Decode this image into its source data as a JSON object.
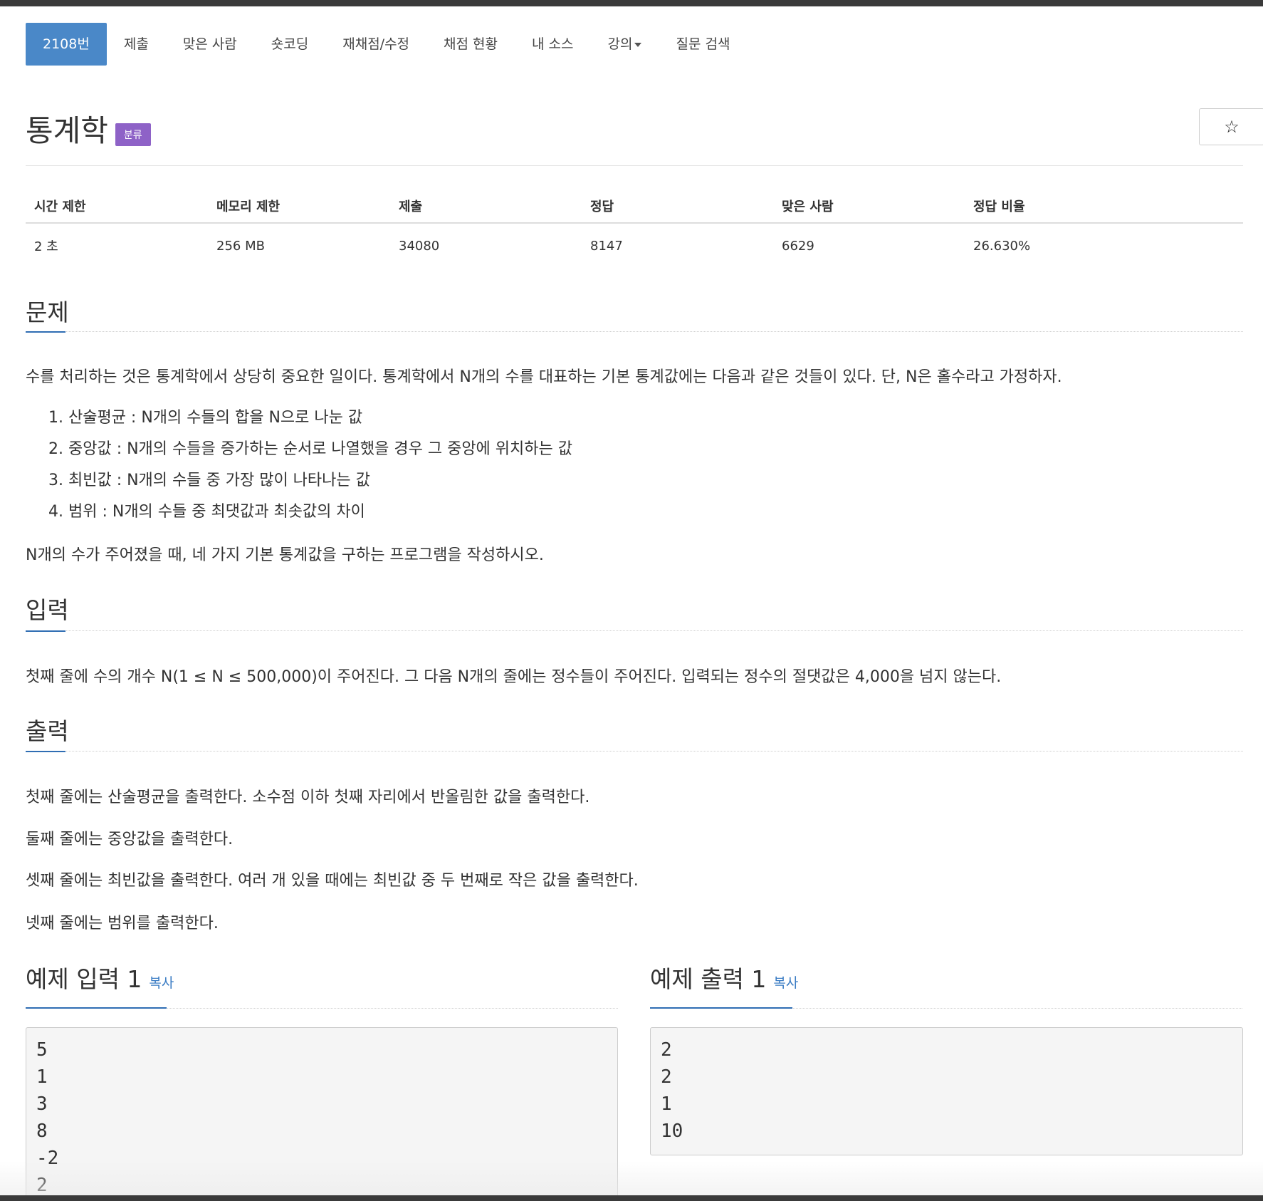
{
  "nav": {
    "items": [
      {
        "label": "2108번",
        "active": true
      },
      {
        "label": "제출"
      },
      {
        "label": "맞은 사람"
      },
      {
        "label": "숏코딩"
      },
      {
        "label": "재채점/수정"
      },
      {
        "label": "채점 현황"
      },
      {
        "label": "내 소스"
      },
      {
        "label": "강의",
        "dropdown": true
      },
      {
        "label": "질문 검색"
      }
    ]
  },
  "problem": {
    "title": "통계학",
    "tag": "분류",
    "star": "☆"
  },
  "info": {
    "headers": [
      "시간 제한",
      "메모리 제한",
      "제출",
      "정답",
      "맞은 사람",
      "정답 비율"
    ],
    "values": [
      "2 초",
      "256 MB",
      "34080",
      "8147",
      "6629",
      "26.630%"
    ]
  },
  "description": {
    "heading": "문제",
    "intro": "수를 처리하는 것은 통계학에서 상당히 중요한 일이다. 통계학에서 N개의 수를 대표하는 기본 통계값에는 다음과 같은 것들이 있다. 단, N은 홀수라고 가정하자.",
    "list": [
      "1. 산술평균 : N개의 수들의 합을 N으로 나눈 값",
      "2. 중앙값 : N개의 수들을 증가하는 순서로 나열했을 경우 그 중앙에 위치하는 값",
      "3. 최빈값 : N개의 수들 중 가장 많이 나타나는 값",
      "4. 범위 : N개의 수들 중 최댓값과 최솟값의 차이"
    ],
    "outro": "N개의 수가 주어졌을 때, 네 가지 기본 통계값을 구하는 프로그램을 작성하시오."
  },
  "input": {
    "heading": "입력",
    "text": "첫째 줄에 수의 개수 N(1 ≤ N ≤ 500,000)이 주어진다. 그 다음 N개의 줄에는 정수들이 주어진다. 입력되는 정수의 절댓값은 4,000을 넘지 않는다."
  },
  "output": {
    "heading": "출력",
    "lines": [
      "첫째 줄에는 산술평균을 출력한다. 소수점 이하 첫째 자리에서 반올림한 값을 출력한다.",
      "둘째 줄에는 중앙값을 출력한다.",
      "셋째 줄에는 최빈값을 출력한다. 여러 개 있을 때에는 최빈값 중 두 번째로 작은 값을 출력한다.",
      "넷째 줄에는 범위를 출력한다."
    ]
  },
  "samples": {
    "input": {
      "heading": "예제 입력 1",
      "copy": "복사",
      "lines": [
        "5",
        "1",
        "3",
        "8",
        "-2",
        "2"
      ]
    },
    "output": {
      "heading": "예제 출력 1",
      "copy": "복사",
      "lines": [
        "2",
        "2",
        "1",
        "10"
      ]
    }
  },
  "colors": {
    "accent": "#4a88c8",
    "badge": "#8e62c7",
    "link": "#3b7dc4"
  }
}
